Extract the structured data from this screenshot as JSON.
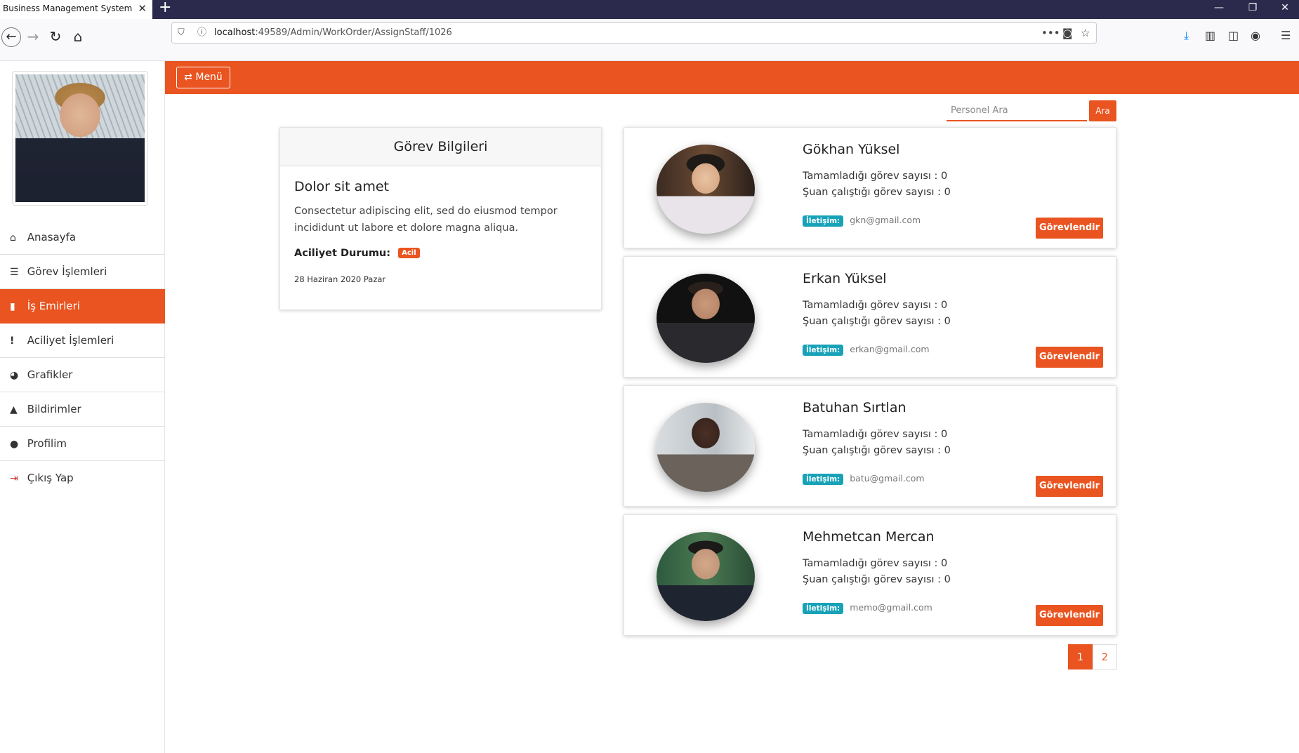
{
  "browser": {
    "tab_title": "Business Management System",
    "url_host": "localhost",
    "url_rest": ":49589/Admin/WorkOrder/AssignStaff/1026"
  },
  "sidebar": {
    "items": [
      {
        "label": "Anasayfa",
        "icon": "home-icon",
        "glyph": "⌂",
        "active": false
      },
      {
        "label": "Görev İşlemleri",
        "icon": "list-icon",
        "glyph": "☰",
        "active": false
      },
      {
        "label": "İş Emirleri",
        "icon": "file-icon",
        "glyph": "▮",
        "active": true
      },
      {
        "label": "Aciliyet İşlemleri",
        "icon": "exclamation-icon",
        "glyph": "!",
        "active": false
      },
      {
        "label": "Grafikler",
        "icon": "pie-chart-icon",
        "glyph": "◕",
        "active": false
      },
      {
        "label": "Bildirimler",
        "icon": "bell-icon",
        "glyph": "🔔",
        "active": false
      },
      {
        "label": "Profilim",
        "icon": "user-icon",
        "glyph": "●",
        "active": false
      },
      {
        "label": "Çıkış Yap",
        "icon": "sign-out-icon",
        "glyph": "⇥",
        "active": false
      }
    ]
  },
  "topbar": {
    "menu_label": "Menü",
    "menu_icon": "exchange-icon"
  },
  "search": {
    "placeholder": "Personel Ara",
    "button_label": "Ara"
  },
  "task": {
    "header": "Görev Bilgileri",
    "title": "Dolor sit amet",
    "description": "Consectetur adipiscing elit, sed do eiusmod tempor incididunt ut labore et dolore magna aliqua.",
    "urgency_label": "Aciliyet Durumu:",
    "urgency_badge": "Acil",
    "date": "28 Haziran 2020 Pazar"
  },
  "staff": [
    {
      "name": "Gökhan Yüksel",
      "completed": "Tamamladığı görev sayısı : 0",
      "current": "Şuan çalıştığı görev sayısı : 0",
      "contact_label": "İletişim:",
      "email": "gkn@gmail.com",
      "button": "Görevlendir"
    },
    {
      "name": "Erkan Yüksel",
      "completed": "Tamamladığı görev sayısı : 0",
      "current": "Şuan çalıştığı görev sayısı : 0",
      "contact_label": "İletişim:",
      "email": "erkan@gmail.com",
      "button": "Görevlendir"
    },
    {
      "name": "Batuhan Sırtlan",
      "completed": "Tamamladığı görev sayısı : 0",
      "current": "Şuan çalıştığı görev sayısı : 0",
      "contact_label": "İletişim:",
      "email": "batu@gmail.com",
      "button": "Görevlendir"
    },
    {
      "name": "Mehmetcan Mercan",
      "completed": "Tamamladığı görev sayısı : 0",
      "current": "Şuan çalıştığı görev sayısı : 0",
      "contact_label": "İletişim:",
      "email": "memo@gmail.com",
      "button": "Görevlendir"
    }
  ],
  "pagination": {
    "pages": [
      "1",
      "2"
    ],
    "active": "1"
  },
  "colors": {
    "accent": "#e95420",
    "info": "#17a2b8"
  }
}
